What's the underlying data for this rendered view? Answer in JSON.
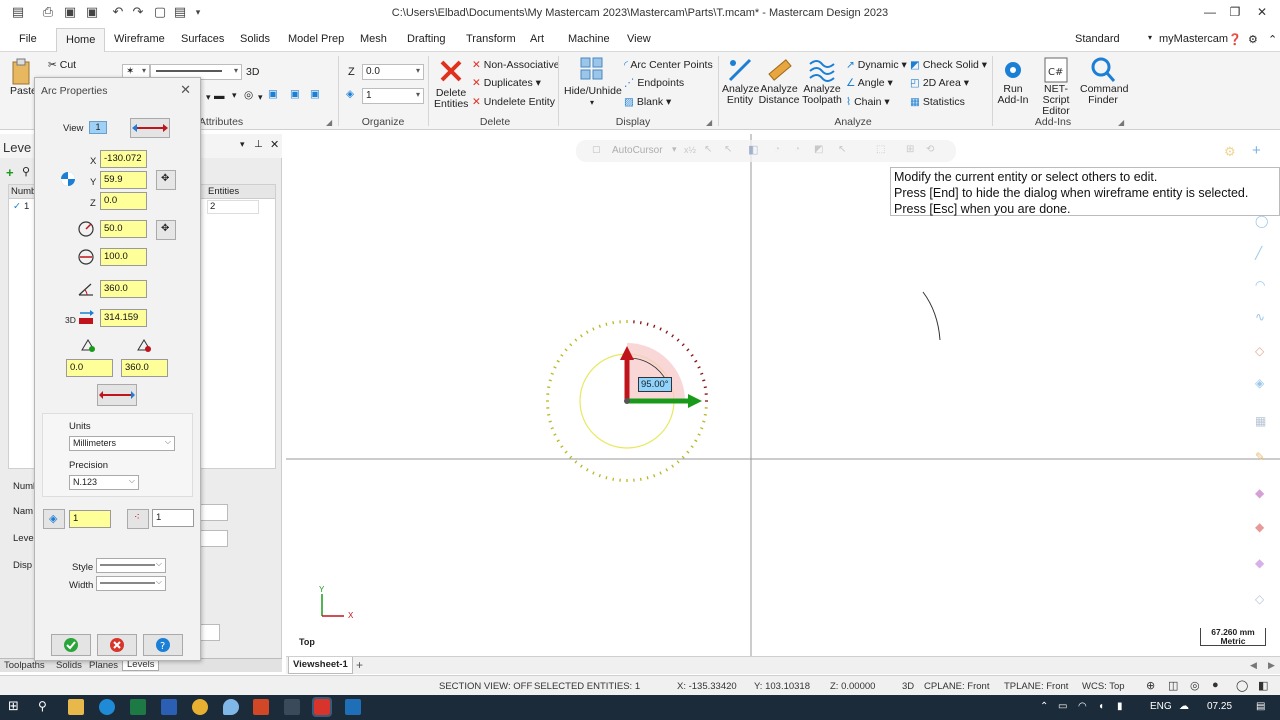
{
  "window": {
    "title": "C:\\Users\\Elbad\\Documents\\My Mastercam 2023\\Mastercam\\Parts\\T.mcam* - Mastercam Design 2023"
  },
  "menu": {
    "tabs": [
      "File",
      "Home",
      "Wireframe",
      "Surfaces",
      "Solids",
      "Model Prep",
      "Mesh",
      "Drafting",
      "Transform",
      "Art",
      "Machine",
      "View"
    ],
    "active": "Home",
    "workspace": "Standard",
    "account": "myMastercam"
  },
  "ribbon": {
    "clipboard": {
      "paste": "Paste",
      "cut": "Cut"
    },
    "attributes": {
      "label": "Attributes",
      "mode": "3D"
    },
    "organize": {
      "label": "Organize",
      "z_label": "Z",
      "z_value": "0.0",
      "level_value": "1"
    },
    "delete": {
      "label": "Delete",
      "delete_entities": "Delete Entities",
      "non_associative": "Non-Associative",
      "duplicates": "Duplicates",
      "undelete_entity": "Undelete Entity"
    },
    "display": {
      "label": "Display",
      "hide_unhide": "Hide/Unhide",
      "arc_center_points": "Arc Center Points",
      "endpoints": "Endpoints",
      "blank": "Blank"
    },
    "analyze": {
      "label": "Analyze",
      "analyze_entity": "Analyze Entity",
      "analyze_distance": "Analyze Distance",
      "analyze_toolpath": "Analyze Toolpath",
      "dynamic": "Dynamic",
      "angle": "Angle",
      "chain": "Chain",
      "check_solid": "Check Solid",
      "area_2d": "2D Area",
      "statistics": "Statistics"
    },
    "addins": {
      "label": "Add-Ins",
      "run_addin": "Run Add-In",
      "net_script": "NET-Script Editor",
      "command_finder": "Command Finder"
    }
  },
  "levels_panel": {
    "title": "Leve",
    "col_number": "Numb",
    "col_entities": "Entities",
    "row_number": "1",
    "row_entities": "2",
    "label_number": "Numb",
    "label_name": "Nam",
    "label_level": "Leve",
    "label_display": "Disp"
  },
  "bottom_tabs": [
    "Toolpaths",
    "Solids",
    "Planes",
    "Levels"
  ],
  "dialog": {
    "title": "Arc Properties",
    "view_label": "View",
    "view_value": "1",
    "x_label": "X",
    "x_value": "-130.072",
    "y_label": "Y",
    "y_value": "59.9",
    "z_label": "Z",
    "z_value": "0.0",
    "radius": "50.0",
    "diameter": "100.0",
    "sweep": "360.0",
    "length_prefix": "3D",
    "length": "314.159",
    "start_angle": "0.0",
    "end_angle": "360.0",
    "units_label": "Units",
    "units_value": "Millimeters",
    "precision_label": "Precision",
    "precision_value": "N.123",
    "level_value": "1",
    "point_value": "1",
    "style_label": "Style",
    "width_label": "Width"
  },
  "graphics": {
    "autocursor": "AutoCursor",
    "prompt": [
      "Modify the current entity or select others to edit.",
      "Press [End] to hide the dialog when wireframe entity is selected.",
      "Press [Esc] when you are done."
    ],
    "angle_tag": "95.00°",
    "axis_y": "Y",
    "axis_x": "X",
    "view_name": "Top",
    "scale_value": "67.260 mm",
    "scale_unit": "Metric",
    "viewsheet": "Viewsheet-1"
  },
  "status": {
    "section_view": "SECTION VIEW: OFF",
    "selected": "SELECTED ENTITIES: 1",
    "x": "X:  -135.33420",
    "y": "Y:  103.10318",
    "z": "Z:  0.00000",
    "mode": "3D",
    "cplane": "CPLANE: Front",
    "tplane": "TPLANE: Front",
    "wcs": "WCS: Top"
  },
  "taskbar": {
    "lang": "ENG",
    "time": "07.25"
  },
  "colors": {
    "field_yellow": "#ffff99",
    "taskbar": "#1c2b3a",
    "gnomon_red": "#c0141c",
    "gnomon_green": "#1a9a1a",
    "highlight_yellow": "#e8e860"
  }
}
